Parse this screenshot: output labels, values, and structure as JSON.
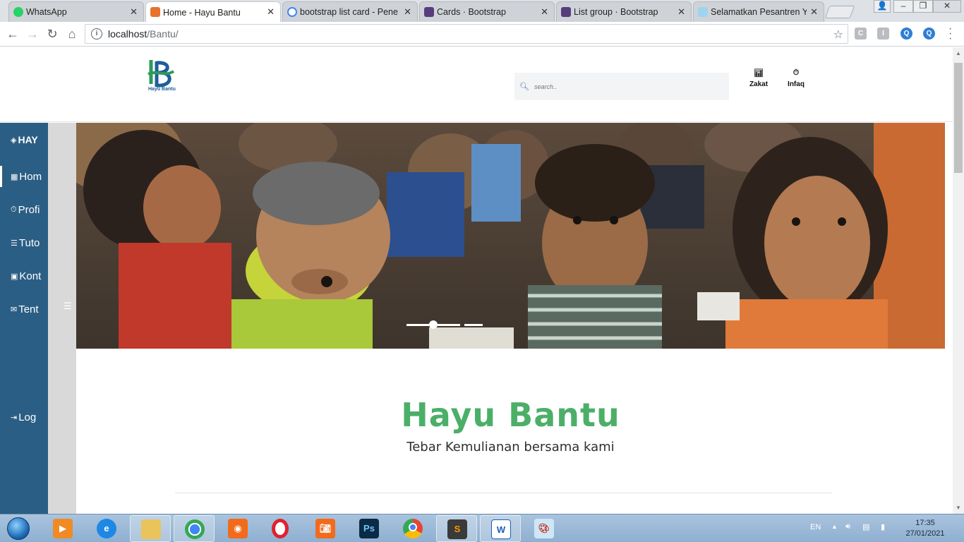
{
  "browser": {
    "tabs": [
      {
        "title": "WhatsApp",
        "active": false,
        "fav_color": "#25d366"
      },
      {
        "title": "Home - Hayu Bantu",
        "active": true,
        "fav_color": "#e8722c"
      },
      {
        "title": "bootstrap list card - Pene",
        "active": false,
        "fav_color": "#4285f4"
      },
      {
        "title": "Cards · Bootstrap",
        "active": false,
        "fav_color": "#563d7c"
      },
      {
        "title": "List group · Bootstrap",
        "active": false,
        "fav_color": "#563d7c"
      },
      {
        "title": "Selamatkan Pesantren Ya",
        "active": false,
        "fav_color": "#9fd3f0"
      }
    ],
    "address": {
      "host": "localhost",
      "path": "/Bantu/"
    }
  },
  "site": {
    "logo_text": "Hayu Bantu",
    "search_placeholder": "search..",
    "header_links": [
      {
        "label": "Zakat",
        "icon": "bar-chart-icon"
      },
      {
        "label": "Infaq",
        "icon": "timer-icon"
      }
    ],
    "sidebar": {
      "brand": "HAY",
      "items": [
        {
          "label": "Hom",
          "icon": "dashboard-icon"
        },
        {
          "label": "Profi",
          "icon": "clock-icon"
        },
        {
          "label": "Tuto",
          "icon": "list-icon"
        },
        {
          "label": "Kont",
          "icon": "contact-icon"
        },
        {
          "label": "Tent",
          "icon": "about-icon"
        }
      ],
      "logout": "Log"
    },
    "hero": {
      "slide_index": 1
    },
    "intro": {
      "title": "Hayu Bantu",
      "subtitle": "Tebar Kemulianan bersama kami"
    },
    "colors": {
      "accent_green": "#4caf68",
      "sidebar_blue": "#2b5e84"
    }
  },
  "taskbar": {
    "language": "EN",
    "time": "17:35",
    "date": "27/01/2021",
    "apps": [
      "Internet Explorer",
      "File Explorer",
      "Chrome",
      "Screen Recorder",
      "Opera",
      "Screenshot",
      "Photoshop",
      "Chrome",
      "Sublime Text",
      "Word",
      "Paint"
    ]
  }
}
